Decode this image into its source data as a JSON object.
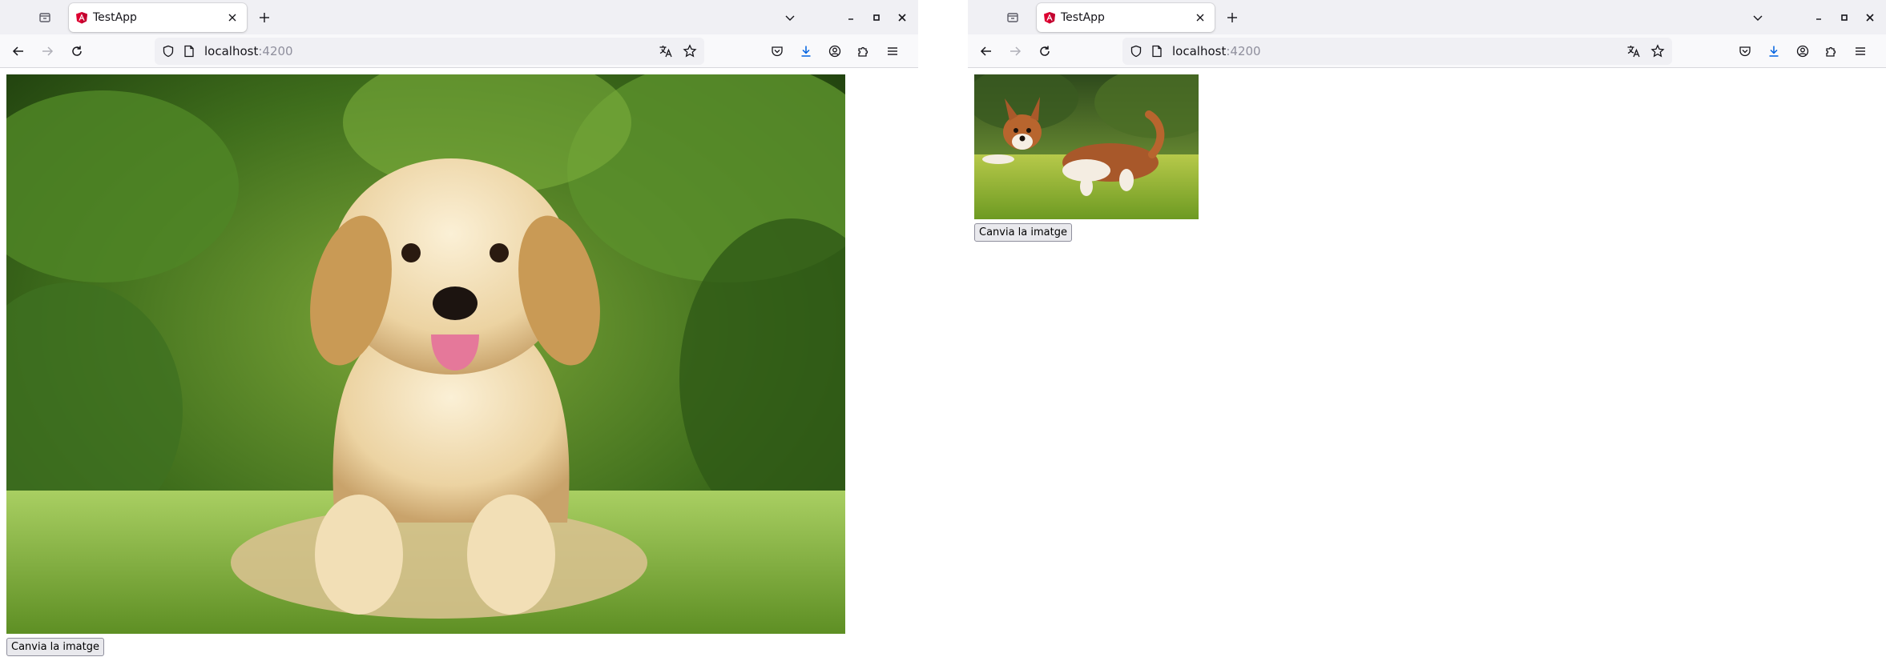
{
  "windows": [
    {
      "tab": {
        "title": "TestApp",
        "favicon": "angular-logo-icon"
      },
      "url": {
        "host": "localhost",
        "port": ":4200"
      },
      "image": {
        "subject": "golden-retriever-puppy-photo"
      },
      "button": {
        "label": "Canvia la imatge"
      }
    },
    {
      "tab": {
        "title": "TestApp",
        "favicon": "angular-logo-icon"
      },
      "url": {
        "host": "localhost",
        "port": ":4200"
      },
      "image": {
        "subject": "corgi-puppy-running-photo"
      },
      "button": {
        "label": "Canvia la imatge"
      }
    }
  ],
  "colors": {
    "tabstrip": "#f0f0f4",
    "navbar": "#f9f9fb",
    "urlbar": "#f0f0f4",
    "angular_brand": "#dd0031",
    "download_accent": "#0061e0",
    "icon": "#5b5b66"
  }
}
